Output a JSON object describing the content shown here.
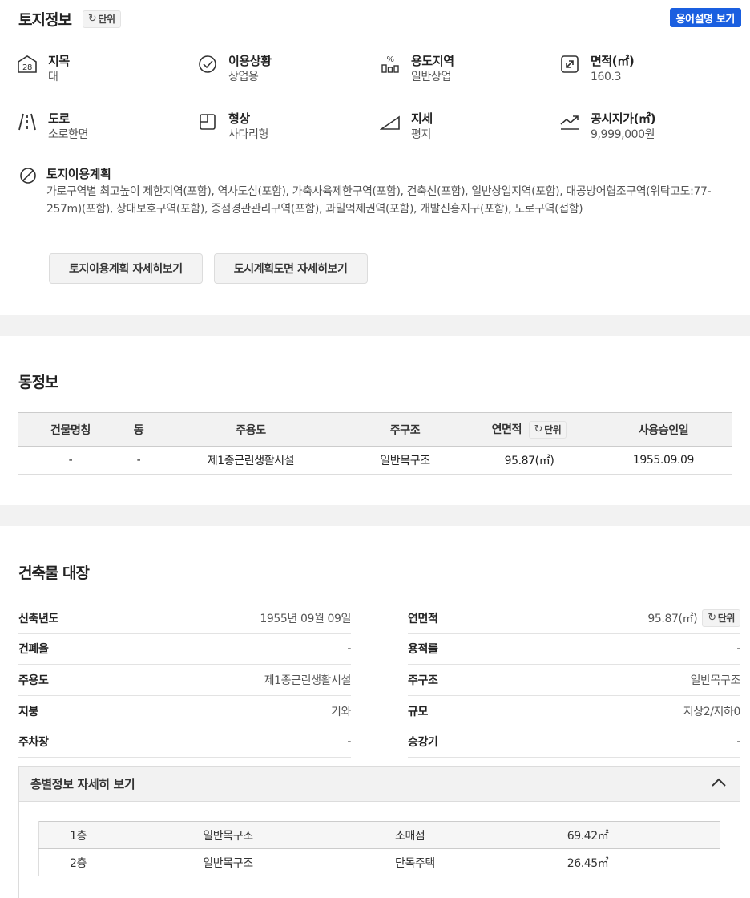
{
  "land": {
    "title": "토지정보",
    "unit_label": "단위",
    "glossary_label": "용어설명 보기",
    "items": [
      {
        "label": "지목",
        "value": "대",
        "icon": "jimok-28-icon"
      },
      {
        "label": "이용상황",
        "value": "상업용",
        "icon": "check-circle-icon"
      },
      {
        "label": "용도지역",
        "value": "일반상업",
        "icon": "percent-bars-icon"
      },
      {
        "label": "면적(㎡)",
        "value": "160.3",
        "icon": "expand-icon"
      },
      {
        "label": "도로",
        "value": "소로한면",
        "icon": "road-icon"
      },
      {
        "label": "형상",
        "value": "사다리형",
        "icon": "shape-icon"
      },
      {
        "label": "지세",
        "value": "평지",
        "icon": "slope-icon"
      },
      {
        "label": "공시지가(㎡)",
        "value": "9,999,000원",
        "icon": "trend-up-icon"
      }
    ],
    "plan_label": "토지이용계획",
    "plan_text": "가로구역별 최고높이 제한지역(포함), 역사도심(포함), 가축사육제한구역(포함), 건축선(포함), 일반상업지역(포함), 대공방어협조구역(위탁고도:77-257m)(포함), 상대보호구역(포함), 중점경관관리구역(포함), 과밀억제권역(포함), 개발진흥지구(포함), 도로구역(접함)",
    "plan_detail_btn": "토지이용계획 자세히보기",
    "map_detail_btn": "도시계획도면 자세히보기"
  },
  "dong": {
    "title": "동정보",
    "headers": [
      "건물명칭",
      "동",
      "주용도",
      "주구조",
      "연면적",
      "사용승인일"
    ],
    "unit_label": "단위",
    "row": [
      "-",
      "-",
      "제1종근린생활시설",
      "일반목구조",
      "95.87(㎡)",
      "1955.09.09"
    ]
  },
  "registry": {
    "title": "건축물 대장",
    "left": [
      {
        "label": "신축년도",
        "value": "1955년 09월 09일"
      },
      {
        "label": "건폐율",
        "value": "-"
      },
      {
        "label": "주용도",
        "value": "제1종근린생활시설"
      },
      {
        "label": "지붕",
        "value": "기와"
      },
      {
        "label": "주차장",
        "value": "-"
      }
    ],
    "right": [
      {
        "label": "연면적",
        "value": "95.87(㎡)"
      },
      {
        "label": "용적률",
        "value": "-"
      },
      {
        "label": "주구조",
        "value": "일반목구조"
      },
      {
        "label": "규모",
        "value": "지상2/지하0"
      },
      {
        "label": "승강기",
        "value": "-"
      }
    ],
    "unit_label": "단위",
    "floor_title": "층별정보 자세히 보기",
    "floors": [
      [
        "1층",
        "일반목구조",
        "소매점",
        "69.42㎡"
      ],
      [
        "2층",
        "일반목구조",
        "단독주택",
        "26.45㎡"
      ]
    ]
  }
}
